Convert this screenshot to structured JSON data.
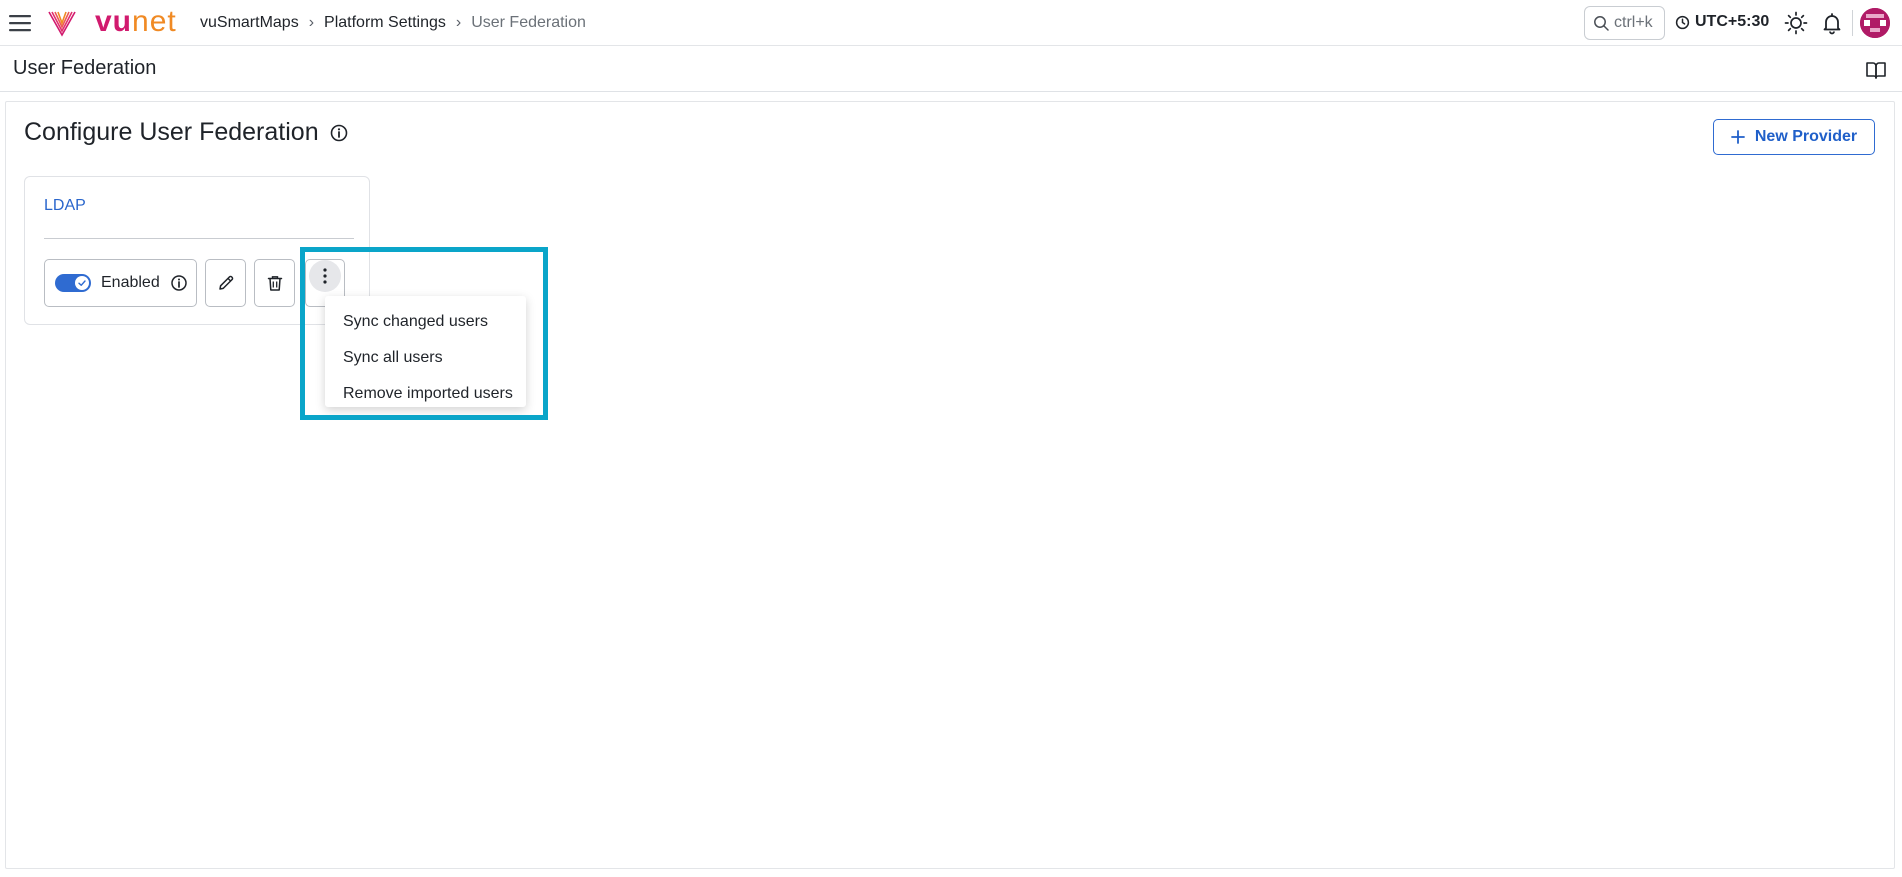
{
  "app": {
    "logo_text_vu": "vu",
    "logo_text_net": "net",
    "brand_colors": {
      "primary": "#d11a6e",
      "secondary": "#f08a24"
    }
  },
  "breadcrumb": {
    "items": [
      {
        "label": "vuSmartMaps"
      },
      {
        "label": "Platform Settings"
      },
      {
        "label": "User Federation"
      }
    ]
  },
  "header_tools": {
    "search_shortcut": "ctrl+k",
    "timezone": "UTC+5:30",
    "icons": [
      "search-icon",
      "clock-icon",
      "sun-icon",
      "bell-icon",
      "avatar"
    ]
  },
  "page": {
    "title": "User Federation",
    "docs_icon": "book-icon"
  },
  "main": {
    "section_title": "Configure User Federation",
    "new_provider_label": "New Provider",
    "accent_color": "#2f6bd1"
  },
  "providers": [
    {
      "name": "LDAP",
      "status_label": "Enabled",
      "enabled": true
    }
  ],
  "context_menu": {
    "items": [
      {
        "label": "Sync changed users"
      },
      {
        "label": "Sync all users"
      },
      {
        "label": "Remove imported users"
      }
    ],
    "highlight_color": "#0aa5c9"
  }
}
